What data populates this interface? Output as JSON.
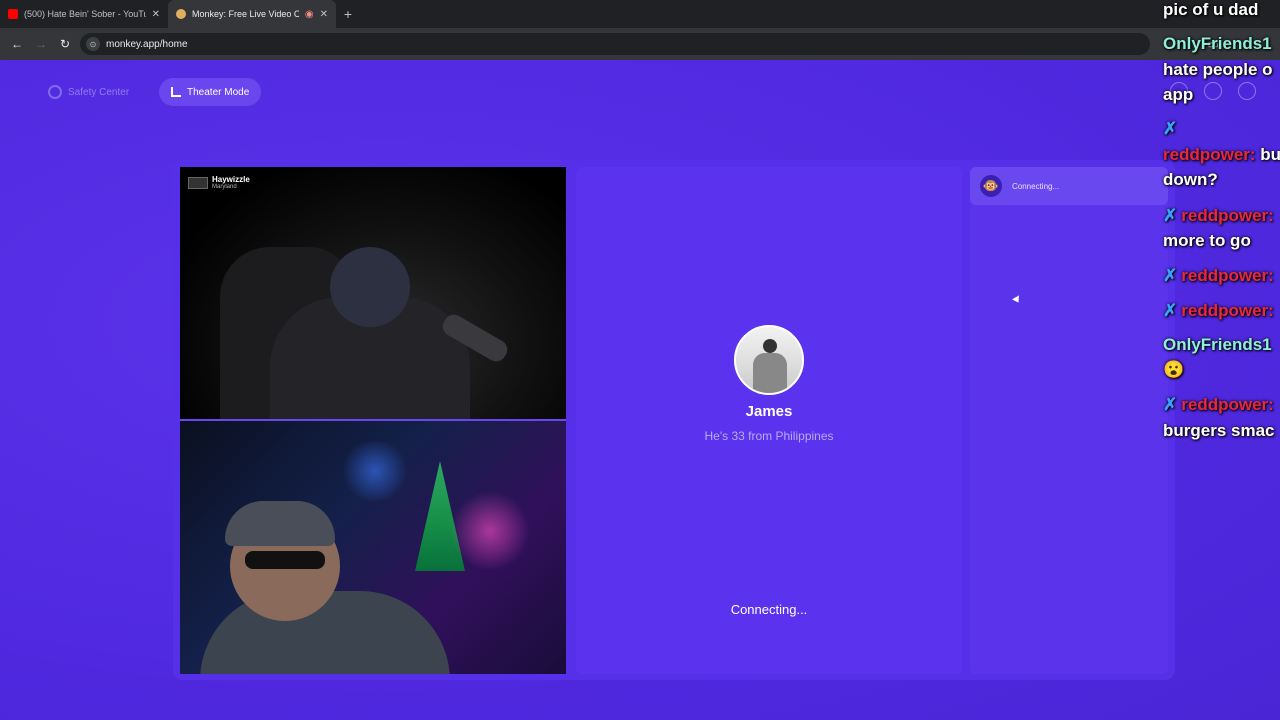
{
  "browser": {
    "tabs": [
      {
        "title": "(500) Hate Bein' Sober - YouTub",
        "favicon_color": "#ff0000",
        "active": false
      },
      {
        "title": "Monkey: Free Live Video Ch",
        "favicon_color": "#e0b060",
        "active": true
      }
    ],
    "url": "monkey.app/home"
  },
  "header": {
    "safety_center": "Safety Center",
    "theater_mode": "Theater Mode"
  },
  "video": {
    "streamer_name": "Haywizzle",
    "streamer_location": "Maryland"
  },
  "peer": {
    "name": "James",
    "info": "He's 33 from Philippines",
    "status": "Connecting..."
  },
  "chat": {
    "status": "Connecting...",
    "status_icon": "monkey-icon"
  },
  "stream_chat": {
    "lines": [
      {
        "text": "pic of u dad",
        "color": "white"
      },
      {
        "text": "OnlyFriends1",
        "color": "green"
      },
      {
        "text": "hate people o",
        "color": "white"
      },
      {
        "text": "app",
        "color": "white"
      },
      {
        "text": "reddpower:",
        "color": "red",
        "suffix": " bu"
      },
      {
        "text": "down?",
        "color": "white"
      },
      {
        "text": "reddpower:",
        "color": "red"
      },
      {
        "text": "more to go",
        "color": "white"
      },
      {
        "text": "reddpower:",
        "color": "red"
      },
      {
        "text": "reddpower:",
        "color": "red"
      },
      {
        "text": "OnlyFriends1",
        "color": "green"
      },
      {
        "text": "reddpower:",
        "color": "red"
      },
      {
        "text": "burgers smac",
        "color": "white"
      }
    ]
  },
  "colors": {
    "page_bg": "#5a2fe8",
    "panel_bg": "#5b33ee",
    "accent": "#6a46ee"
  }
}
